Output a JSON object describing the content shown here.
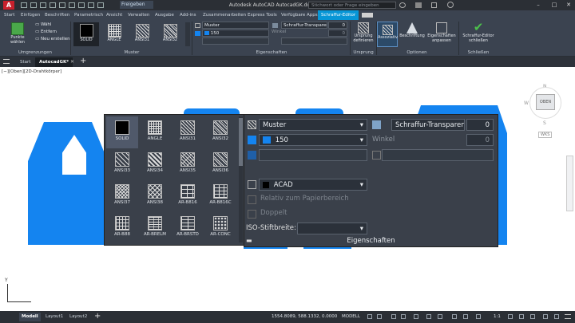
{
  "titlebar": {
    "logo": "A",
    "context_label": "Freigeben",
    "doc_title": "Autodesk AutoCAD AutocadGK.dwg",
    "search_placeholder": "Stichwort oder Frage eingeben"
  },
  "ribbon_tabs": [
    "Start",
    "Einfügen",
    "Beschriften",
    "Parametrisch",
    "Ansicht",
    "Verwalten",
    "Ausgabe",
    "Add-ins",
    "Zusammenarbeiten",
    "Express Tools",
    "Verfügbare Apps",
    "Schraffur-Editor"
  ],
  "active_tab": "Schraffur-Editor",
  "ribbon": {
    "umgrenzungen": {
      "label": "Umgrenzungen",
      "pick_points": "Punkte wählen",
      "select": "Wähl",
      "remove": "Entfern",
      "recreate": "Neu erstellen"
    },
    "muster": {
      "label": "Muster",
      "items": [
        "SOLID",
        "ANGLE",
        "ANSI31",
        "ANSI32"
      ]
    },
    "eigenschaften": {
      "label": "Eigenschaften",
      "type_value": "Muster",
      "color_value": "150",
      "transparency_label": "Schraffur-Transparenz",
      "transparency_value": "0",
      "angle_label": "Winkel",
      "angle_value": "0"
    },
    "ursprung": {
      "label": "Ursprung",
      "set_origin": "Ursprung definieren"
    },
    "optionen": {
      "label": "Optionen",
      "associative": "Assoziativ",
      "annotative": "Beschriftung",
      "match_props": "Eigenschaften anpassen"
    },
    "schliessen": {
      "label": "Schließen",
      "close": "Schraffur-Editor schließen"
    }
  },
  "doc_tabs": {
    "start": "Start",
    "file": "AutocadGK*"
  },
  "viewport_label": "[−][Oben][2D-Drahtkörper]",
  "hatch_gallery": {
    "items": [
      "SOLID",
      "ANGLE",
      "ANSI31",
      "ANSI32",
      "ANSI33",
      "ANSI34",
      "ANSI35",
      "ANSI36",
      "ANSI37",
      "ANSI38",
      "AR-B816",
      "AR-B816C",
      "AR-B88",
      "AR-BRELM",
      "AR-BRSTD",
      "AR-CONC"
    ],
    "selected": "SOLID"
  },
  "properties_flyout": {
    "type_value": "Muster",
    "color_value": "150",
    "transparency_label": "Schraffur-Transparenz",
    "transparency_value": "0",
    "angle_label": "Winkel",
    "angle_value": "0",
    "scale_value": "ACAD",
    "relative_paper": "Relativ zum Papierbereich",
    "double": "Doppelt",
    "iso_pen_width": "ISO-Stiftbreite:",
    "footer": "Eigenschaften"
  },
  "viewcube": {
    "north": "N",
    "south": "S",
    "west": "W",
    "face": "OBEN",
    "wcs": "WKS"
  },
  "ucs": {
    "y": "Y"
  },
  "status_tabs": [
    "Modell",
    "Layout1",
    "Layout2"
  ],
  "status": {
    "coords": "1554.8089, 588.1332, 0.0000",
    "mode": "MODELL",
    "scale": "1:1"
  },
  "colors": {
    "accent": "#0796d6",
    "hatch_blue": "#1484f0",
    "ribbon_bg": "#3b4350"
  }
}
